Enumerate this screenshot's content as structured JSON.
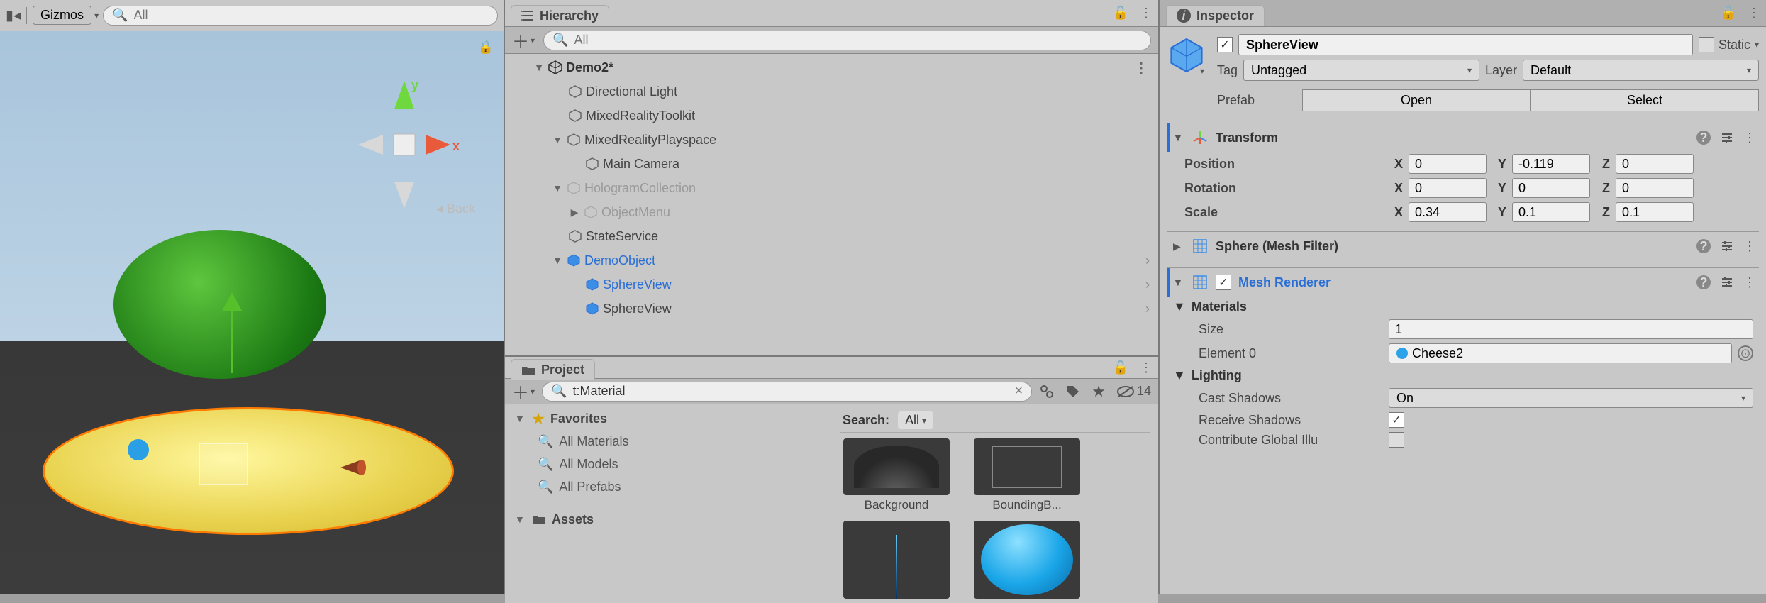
{
  "scene": {
    "gizmos_label": "Gizmos",
    "search_placeholder": "All",
    "back_label": "Back",
    "axes": {
      "x": "x",
      "y": "y"
    }
  },
  "hierarchy": {
    "tab_label": "Hierarchy",
    "search_placeholder": "All",
    "scene_name": "Demo2*",
    "items": [
      {
        "label": "Directional Light"
      },
      {
        "label": "MixedRealityToolkit"
      },
      {
        "label": "MixedRealityPlayspace"
      },
      {
        "label": "Main Camera"
      },
      {
        "label": "HologramCollection"
      },
      {
        "label": "ObjectMenu"
      },
      {
        "label": "StateService"
      },
      {
        "label": "DemoObject"
      },
      {
        "label": "SphereView"
      },
      {
        "label": "SphereView"
      }
    ]
  },
  "project": {
    "tab_label": "Project",
    "search_value": "t:Material",
    "hidden_count": "14",
    "favorites_label": "Favorites",
    "fav_items": [
      "All Materials",
      "All Models",
      "All Prefabs"
    ],
    "assets_label": "Assets",
    "search_hdr": "Search:",
    "search_scope": "All",
    "thumbs": [
      "Background",
      "BoundingB..."
    ]
  },
  "inspector": {
    "tab_label": "Inspector",
    "name": "SphereView",
    "active": true,
    "static_label": "Static",
    "tag_label": "Tag",
    "tag_value": "Untagged",
    "layer_label": "Layer",
    "layer_value": "Default",
    "prefab_label": "Prefab",
    "open_label": "Open",
    "select_label": "Select",
    "transform": {
      "title": "Transform",
      "position_label": "Position",
      "rotation_label": "Rotation",
      "scale_label": "Scale",
      "position": {
        "x": "0",
        "y": "-0.119",
        "z": "0"
      },
      "rotation": {
        "x": "0",
        "y": "0",
        "z": "0"
      },
      "scale": {
        "x": "0.34",
        "y": "0.1",
        "z": "0.1"
      }
    },
    "mesh_filter": {
      "title": "Sphere (Mesh Filter)"
    },
    "mesh_renderer": {
      "title": "Mesh Renderer",
      "materials_label": "Materials",
      "size_label": "Size",
      "size_value": "1",
      "element0_label": "Element 0",
      "element0_value": "Cheese2",
      "lighting_label": "Lighting",
      "cast_shadows_label": "Cast Shadows",
      "cast_shadows_value": "On",
      "receive_shadows_label": "Receive Shadows",
      "receive_shadows": true,
      "contribute_gi_label": "Contribute Global Illu"
    }
  }
}
